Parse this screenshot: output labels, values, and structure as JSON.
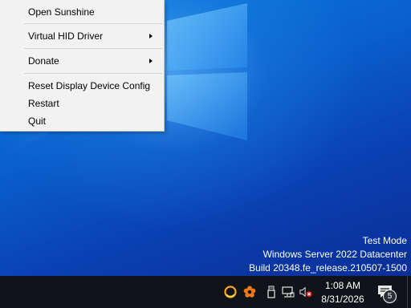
{
  "context_menu": {
    "items": [
      {
        "label": "Open Sunshine",
        "has_submenu": false
      },
      {
        "label": "Virtual HID Driver",
        "has_submenu": true
      },
      {
        "label": "Donate",
        "has_submenu": true
      },
      {
        "label": "Reset Display Device Config",
        "has_submenu": false
      },
      {
        "label": "Restart",
        "has_submenu": false
      },
      {
        "label": "Quit",
        "has_submenu": false
      }
    ]
  },
  "watermark": {
    "line1": "Test Mode",
    "line2": "Windows Server 2022 Datacenter",
    "line3": "Build 20348.fe_release.210507-1500"
  },
  "taskbar": {
    "tray_icons": [
      "sunshine-icon",
      "flower-icon",
      "usb-icon",
      "network-icon",
      "volume-muted-icon"
    ],
    "clock": {
      "time": "1:08 AM",
      "date": "8/31/2026"
    },
    "notifications": {
      "count": "5",
      "icon": "action-center-icon"
    }
  },
  "colors": {
    "taskbar": "#101318",
    "menu_background": "#f2f2f2",
    "desktop_blue": "#0a5fcf"
  }
}
